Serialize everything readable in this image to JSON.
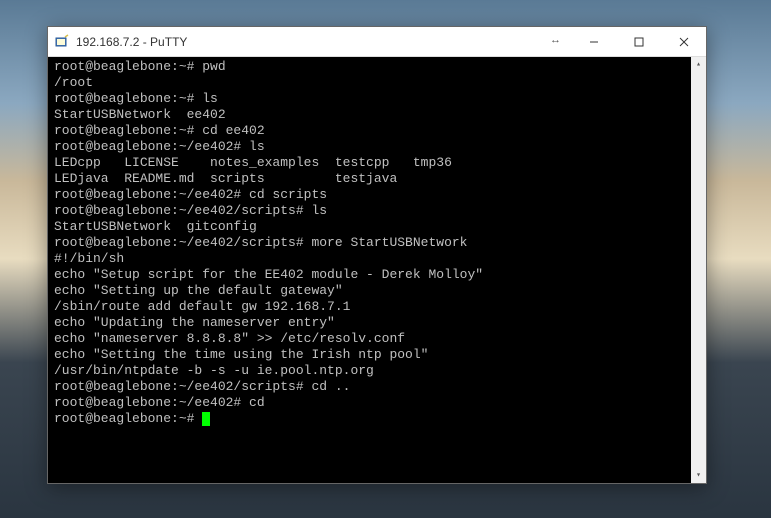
{
  "window": {
    "title": "192.168.7.2 - PuTTY"
  },
  "terminal": {
    "lines": [
      "root@beaglebone:~# pwd",
      "/root",
      "root@beaglebone:~# ls",
      "StartUSBNetwork  ee402",
      "root@beaglebone:~# cd ee402",
      "root@beaglebone:~/ee402# ls",
      "LEDcpp   LICENSE    notes_examples  testcpp   tmp36",
      "LEDjava  README.md  scripts         testjava",
      "root@beaglebone:~/ee402# cd scripts",
      "root@beaglebone:~/ee402/scripts# ls",
      "StartUSBNetwork  gitconfig",
      "root@beaglebone:~/ee402/scripts# more StartUSBNetwork",
      "#!/bin/sh",
      "echo \"Setup script for the EE402 module - Derek Molloy\"",
      "echo \"Setting up the default gateway\"",
      "/sbin/route add default gw 192.168.7.1",
      "",
      "echo \"Updating the nameserver entry\"",
      "echo \"nameserver 8.8.8.8\" >> /etc/resolv.conf",
      "",
      "echo \"Setting the time using the Irish ntp pool\"",
      "/usr/bin/ntpdate -b -s -u ie.pool.ntp.org",
      "root@beaglebone:~/ee402/scripts# cd ..",
      "root@beaglebone:~/ee402# cd",
      "root@beaglebone:~# "
    ]
  }
}
